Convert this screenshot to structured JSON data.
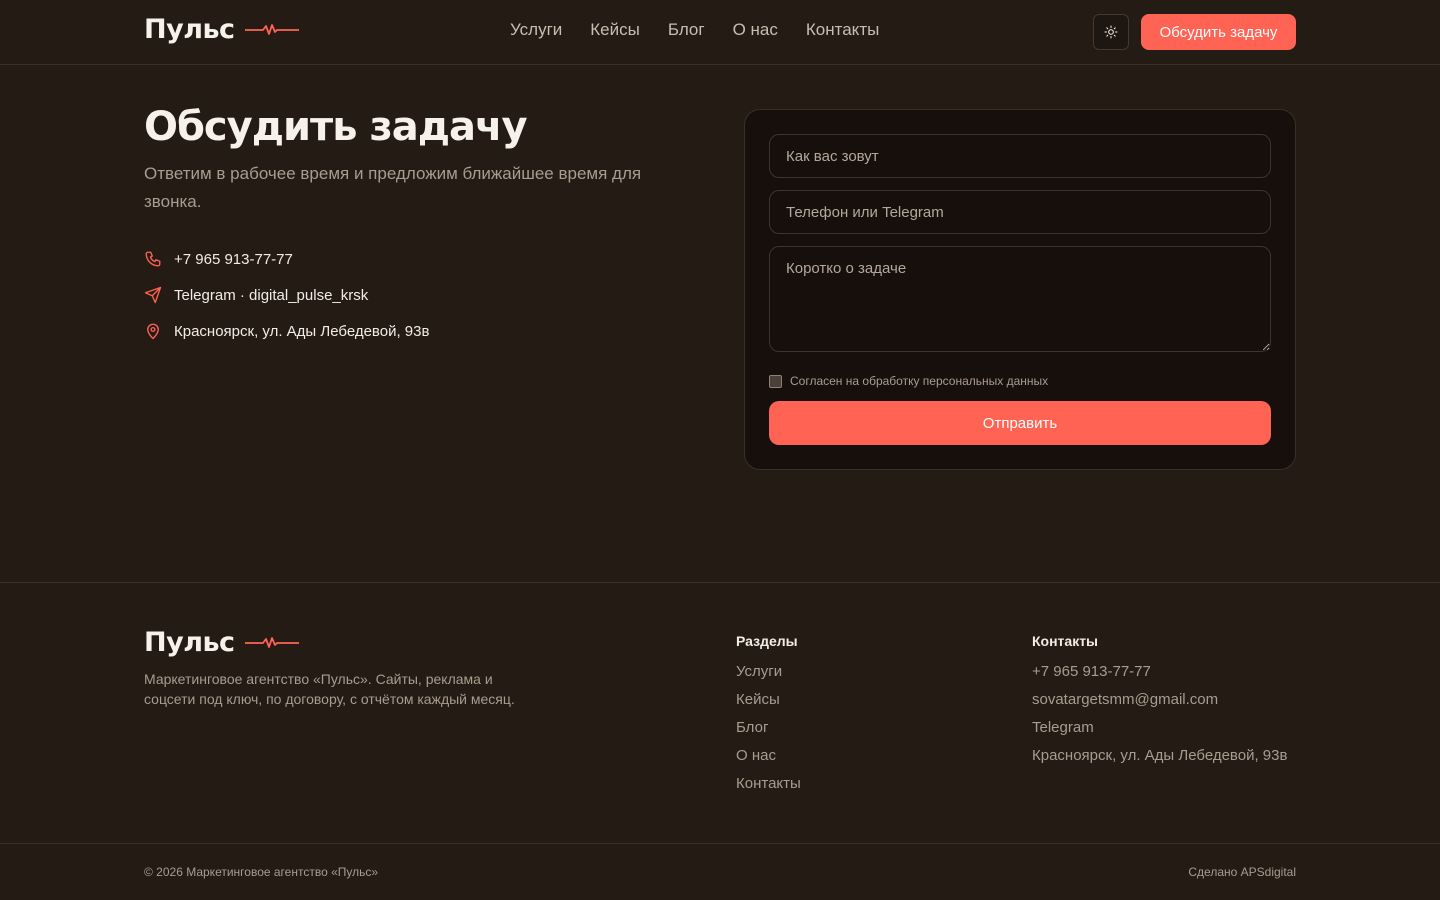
{
  "header": {
    "logo": "Пульс",
    "nav": [
      "Услуги",
      "Кейсы",
      "Блог",
      "О нас",
      "Контакты"
    ],
    "theme_icon": "sun-icon",
    "cta_label": "Обсудить задачу"
  },
  "hero": {
    "title": "Обсудить задачу",
    "subtitle": "Ответим в рабочее время и предложим ближайшее время для звонка.",
    "contacts": {
      "phone": "+7 965 913-77-77",
      "telegram": "Telegram · digital_pulse_krsk",
      "address": "Красноярск, ул. Ады Лебедевой, 93в"
    }
  },
  "form": {
    "name_placeholder": "Как вас зовут",
    "phone_placeholder": "Телефон или Telegram",
    "task_placeholder": "Коротко о задаче",
    "consent_label": "Согласен на обработку персональных данных",
    "submit_label": "Отправить"
  },
  "footer": {
    "logo": "Пульс",
    "description": "Маркетинговое агентство «Пульс». Сайты, реклама и соцсети под ключ, по договору, с отчётом каждый месяц.",
    "sections_title": "Разделы",
    "sections": [
      "Услуги",
      "Кейсы",
      "Блог",
      "О нас",
      "Контакты"
    ],
    "contacts_title": "Контакты",
    "contacts": [
      "+7 965 913-77-77",
      "sovatargetsmm@gmail.com",
      "Telegram",
      "Красноярск, ул. Ады Лебедевой, 93в"
    ],
    "copyright": "© 2026 Маркетинговое агентство «Пульс»",
    "made_by": "Сделано APSdigital"
  },
  "colors": {
    "accent": "#ff6354",
    "background": "#241b14",
    "card": "#160f0b"
  }
}
